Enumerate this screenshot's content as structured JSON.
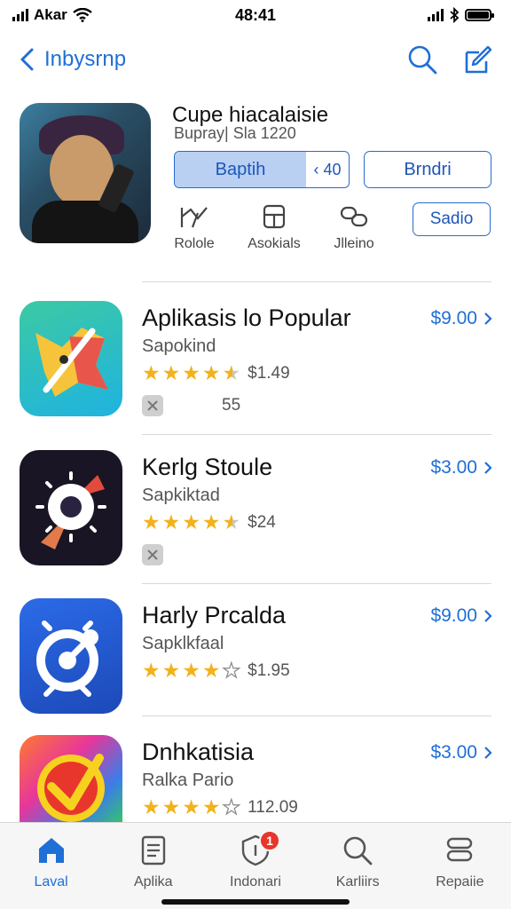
{
  "status": {
    "carrier": "Akar",
    "time": "48:41"
  },
  "nav": {
    "back_label": "Inbysrnp"
  },
  "hero": {
    "title": "Cupe hiacalaisie",
    "subtitle": "Bupray| Sla 1220",
    "segment_primary": "Baptih",
    "segment_secondary": "‹ 40",
    "button_right": "Brndri",
    "button_small": "Sadio",
    "actions": [
      {
        "label": "Rolole",
        "icon": "chart-icon"
      },
      {
        "label": "Asokials",
        "icon": "calendar-icon"
      },
      {
        "label": "Jlleino",
        "icon": "link-icon"
      }
    ]
  },
  "apps": [
    {
      "name": "Aplikasis lo Popular",
      "subtitle": "Sapokind",
      "price": "$9.00",
      "rating": 4.5,
      "rating_label": "$1.49",
      "extra": "55",
      "icon": "fox-app-icon"
    },
    {
      "name": "Kerlg Stoule",
      "subtitle": "Sapkiktad",
      "price": "$3.00",
      "rating": 4.5,
      "rating_label": "$24",
      "extra": "",
      "icon": "compass-app-icon"
    },
    {
      "name": "Harly Prcalda",
      "subtitle": "Sapklkfaal",
      "price": "$9.00",
      "rating": 4,
      "rating_label": "$1.95",
      "extra": "",
      "icon": "timer-app-icon"
    },
    {
      "name": "Dnhkatisia",
      "subtitle": "Ralka Pario",
      "price": "$3.00",
      "rating": 4,
      "rating_label": "112.09",
      "extra": "",
      "icon": "play-app-icon"
    }
  ],
  "tabs": [
    {
      "label": "Laval",
      "icon": "home-icon",
      "active": true
    },
    {
      "label": "Aplika",
      "icon": "document-icon",
      "active": false
    },
    {
      "label": "Indonari",
      "icon": "shield-icon",
      "active": false,
      "badge": "1"
    },
    {
      "label": "Karliirs",
      "icon": "search-icon",
      "active": false
    },
    {
      "label": "Repaiie",
      "icon": "stack-icon",
      "active": false
    }
  ],
  "colors": {
    "accent": "#1f6fd6",
    "star": "#f3b21b",
    "badge": "#e8362d"
  }
}
